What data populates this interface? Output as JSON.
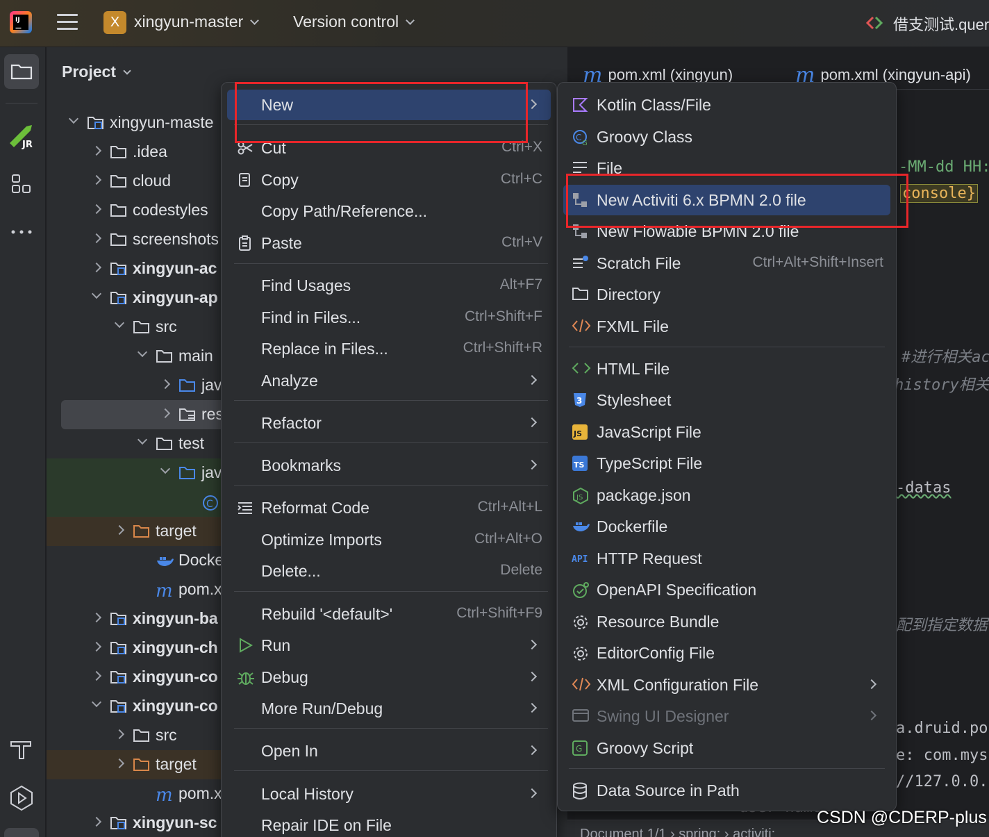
{
  "titlebar": {
    "project_badge": "X",
    "project_name": "xingyun-master",
    "vcs_label": "Version control",
    "run_config": "借支测试.quer"
  },
  "project_panel": {
    "title": "Project",
    "tree": [
      {
        "label": "xingyun-maste",
        "bold": false
      },
      {
        "label": ".idea"
      },
      {
        "label": "cloud"
      },
      {
        "label": "codestyles"
      },
      {
        "label": "screenshots"
      },
      {
        "label": "xingyun-ac"
      },
      {
        "label": "xingyun-ap"
      },
      {
        "label": "src"
      },
      {
        "label": "main"
      },
      {
        "label": "jav"
      },
      {
        "label": "res"
      },
      {
        "label": "test"
      },
      {
        "label": "jav"
      },
      {
        "label": ""
      },
      {
        "label": "target"
      },
      {
        "label": "Dockerfil"
      },
      {
        "label": "pom.xml"
      },
      {
        "label": "xingyun-ba"
      },
      {
        "label": "xingyun-ch"
      },
      {
        "label": "xingyun-co"
      },
      {
        "label": "xingyun-co"
      },
      {
        "label": "src"
      },
      {
        "label": "target"
      },
      {
        "label": "pom.xml"
      },
      {
        "label": "xingyun-sc"
      }
    ]
  },
  "editor": {
    "tabs": [
      {
        "prefix": "m",
        "label": "pom.xml (xingyun)"
      },
      {
        "prefix": "m",
        "label": "pom.xml (xingyun-api)"
      }
    ],
    "code_fragments": [
      "-MM-dd HH:",
      "console}",
      "#进行相关ac",
      "history相关",
      "-datas",
      "配到指定数据",
      "a.druid.po",
      "e: com.mys",
      "//127.0.0.",
      "user-name"
    ],
    "statusbar": "Document 1/1  ›  spring:  ›  activiti:"
  },
  "context_menu": {
    "items": [
      {
        "label": "New",
        "underline": "N",
        "shortcut": "",
        "submenu": true,
        "selected": true
      },
      {
        "label": "Cut",
        "shortcut": "Ctrl+X",
        "icon": "scissors-icon"
      },
      {
        "label": "Copy",
        "shortcut": "Ctrl+C",
        "icon": "copy-icon"
      },
      {
        "label": "Copy Path/Reference...",
        "shortcut": ""
      },
      {
        "label": "Paste",
        "shortcut": "Ctrl+V",
        "icon": "clipboard-icon"
      },
      {
        "label": "Find Usages",
        "shortcut": "Alt+F7"
      },
      {
        "label": "Find in Files...",
        "shortcut": "Ctrl+Shift+F"
      },
      {
        "label": "Replace in Files...",
        "shortcut": "Ctrl+Shift+R"
      },
      {
        "label": "Analyze",
        "submenu": true
      },
      {
        "label": "Refactor",
        "submenu": true
      },
      {
        "label": "Bookmarks",
        "submenu": true
      },
      {
        "label": "Reformat Code",
        "shortcut": "Ctrl+Alt+L",
        "icon": "reformat-icon"
      },
      {
        "label": "Optimize Imports",
        "shortcut": "Ctrl+Alt+O"
      },
      {
        "label": "Delete...",
        "shortcut": "Delete"
      },
      {
        "label": "Rebuild '<default>'",
        "shortcut": "Ctrl+Shift+F9"
      },
      {
        "label": "Run",
        "submenu": true,
        "icon": "run-icon"
      },
      {
        "label": "Debug",
        "submenu": true,
        "icon": "debug-icon"
      },
      {
        "label": "More Run/Debug",
        "submenu": true
      },
      {
        "label": "Open In",
        "submenu": true
      },
      {
        "label": "Local History",
        "submenu": true
      },
      {
        "label": "Repair IDE on File"
      }
    ]
  },
  "new_submenu": {
    "items": [
      {
        "label": "Kotlin Class/File",
        "icon": "kotlin-icon"
      },
      {
        "label": "Groovy Class",
        "icon": "groovy-class-icon"
      },
      {
        "label": "File",
        "icon": "file-icon"
      },
      {
        "label": "New Activiti 6.x BPMN 2.0 file",
        "icon": "bpmn-icon",
        "selected": true
      },
      {
        "label": "New Flowable BPMN 2.0 file",
        "icon": "bpmn-icon"
      },
      {
        "label": "Scratch File",
        "shortcut": "Ctrl+Alt+Shift+Insert",
        "icon": "scratch-icon"
      },
      {
        "label": "Directory",
        "icon": "folder-icon"
      },
      {
        "label": "FXML File",
        "icon": "xml-tag-icon"
      },
      {
        "label": "HTML File",
        "icon": "html-icon"
      },
      {
        "label": "Stylesheet",
        "icon": "css-icon"
      },
      {
        "label": "JavaScript File",
        "icon": "js-icon"
      },
      {
        "label": "TypeScript File",
        "icon": "ts-icon"
      },
      {
        "label": "package.json",
        "icon": "nodejs-icon"
      },
      {
        "label": "Dockerfile",
        "icon": "docker-icon"
      },
      {
        "label": "HTTP Request",
        "icon": "api-icon"
      },
      {
        "label": "OpenAPI Specification",
        "icon": "openapi-icon"
      },
      {
        "label": "Resource Bundle",
        "icon": "gear-icon"
      },
      {
        "label": "EditorConfig File",
        "icon": "gear-icon"
      },
      {
        "label": "XML Configuration File",
        "icon": "xml-tag-icon",
        "submenu": true
      },
      {
        "label": "Swing UI Designer",
        "icon": "window-icon",
        "submenu": true,
        "disabled": true
      },
      {
        "label": "Groovy Script",
        "icon": "groovy-script-icon"
      },
      {
        "label": "Data Source in Path",
        "icon": "database-icon"
      }
    ]
  },
  "watermark": "CSDN @CDERP-plus",
  "colors": {
    "accent_selection": "#2e436e",
    "highlight_box": "#e8262a",
    "folder_blue": "#4a88e8",
    "target_orange": "#d9874a"
  }
}
